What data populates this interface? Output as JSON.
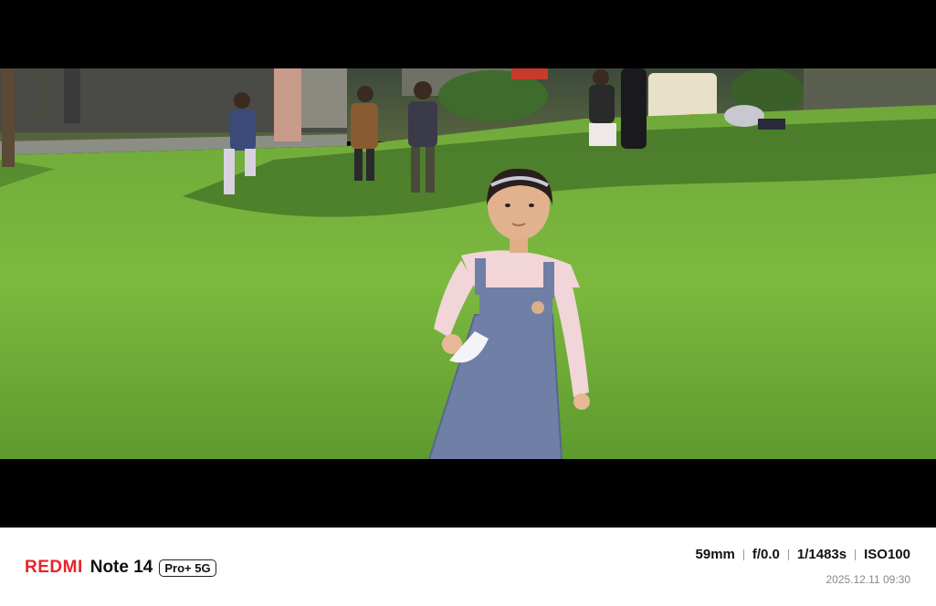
{
  "watermark": {
    "brand": "REDMI",
    "model": "Note 14",
    "badge": "Pro+ 5G",
    "focal_length": "59mm",
    "aperture": "f/0.0",
    "shutter": "1/1483s",
    "iso": "ISO100",
    "datetime": "2025.12.11 09:30"
  },
  "colors": {
    "brand_red": "#e8232b",
    "grass": "#6fb03a",
    "background": "#000000",
    "bar": "#ffffff"
  }
}
